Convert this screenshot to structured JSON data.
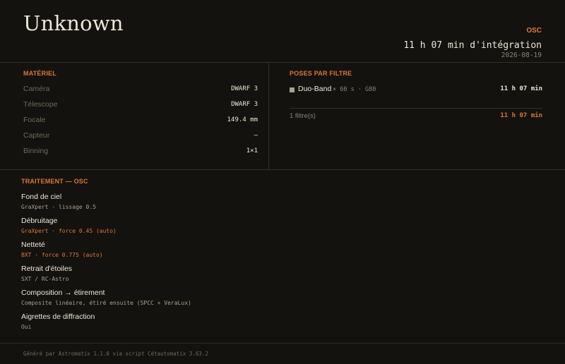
{
  "header": {
    "title": "Unknown",
    "mode_tag": "OSC",
    "integration": "11 h 07 min d'intégration",
    "date": "2026-08-19"
  },
  "equipment": {
    "title": "MATÉRIEL",
    "rows": [
      {
        "label": "Caméra",
        "value": "DWARF 3"
      },
      {
        "label": "Télescope",
        "value": "DWARF 3"
      },
      {
        "label": "Focale",
        "value": "149.4 mm"
      },
      {
        "label": "Capteur",
        "value": "–"
      },
      {
        "label": "Binning",
        "value": "1×1"
      }
    ]
  },
  "filters": {
    "title": "POSES PAR FILTRE",
    "rows": [
      {
        "name": "Duo-Band",
        "detail": "× 60 s · G80",
        "total": "11 h 07 min",
        "color": "#a9a293"
      }
    ],
    "summary_label": "1 filtre(s)",
    "summary_total": "11 h 07 min"
  },
  "processing": {
    "title": "TRAITEMENT — OSC",
    "steps": [
      {
        "title": "Fond de ciel",
        "detail": "GraXpert · lissage 0.5",
        "accent": false
      },
      {
        "title": "Débruitage",
        "detail": "GraXpert · force 0.45 (auto)",
        "accent": true
      },
      {
        "title": "Netteté",
        "detail": "BXT · force 0.775 (auto)",
        "accent": true
      },
      {
        "title": "Retrait d'étoiles",
        "detail": "SXT / RC-Astro",
        "accent": false
      },
      {
        "title": "Composition → étirement",
        "detail": "Composite linéaire, étiré ensuite (SPCC + VeraLux)",
        "accent": false
      },
      {
        "title": "Aigrettes de diffraction",
        "detail": "Oui",
        "accent": false
      }
    ]
  },
  "footer": {
    "text": "Généré par Astromatix 1.1.0 via script Cétautomatix 3.63.2"
  },
  "colors": {
    "accent": "#d9783a",
    "background": "#14120e",
    "text": "#ece6d8",
    "muted": "#6e695f"
  }
}
